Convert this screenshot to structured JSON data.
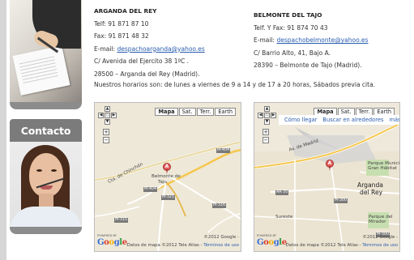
{
  "sidebar": {
    "contact_title": "Contacto"
  },
  "offices": [
    {
      "name": "ARGANDA DEL REY",
      "phone": "Telf: 91 871 87 10",
      "fax": "Fax: 91 871 48 32",
      "email_label": "E-mail: ",
      "email": "despachoarganda@yahoo.es",
      "address": "C/ Avenida del Ejercito 38 1ºC .",
      "city": "28500 – Arganda del Rey (Madrid)."
    },
    {
      "name": "BELMONTE DEL TAJO",
      "phone": "Telf. Y Fax: 91 874 70 43",
      "email_label": "E-mail: ",
      "email": "despachobelmonte@yahoo.es",
      "address": "C/ Barrio Alto, 41, Bajo A.",
      "city": "28390 – Belmonte de Tajo (Madrid)."
    }
  ],
  "hours_text": "Nuestros horarios son: de lunes a viernes de 9 a 14 y de 17 a 20 horas, Sábados previa cita.",
  "map_controls": {
    "types": [
      "Mapa",
      "Sat.",
      "Terr.",
      "Earth"
    ],
    "active_type": "Mapa",
    "pan_up": "▲",
    "pan_left": "◀",
    "pan_right": "▶",
    "pan_down": "▼",
    "pan_center": "◇",
    "zoom_in": "+",
    "zoom_out": "−"
  },
  "map1": {
    "marker_letter": "A",
    "place_label_1": "Belmonte de",
    "place_label_2": "Tajo",
    "road_label": "Cta. de Chinchón",
    "roads": [
      "M-404",
      "M-404",
      "M-321",
      "M-316",
      "M-315"
    ],
    "powered_by": "POWERED BY",
    "logo": "Google",
    "data_attribution": "Datos de mapa ©2012 Tele Atlas -",
    "terms": "Términos de uso",
    "copyright": "©2012 Google -"
  },
  "map2": {
    "marker_letter": "A",
    "toolbar": [
      "Cómo llegar",
      "Buscar en alrededores",
      "más »"
    ],
    "city_label_1": "Arganda",
    "city_label_2": "del Rey",
    "road_label": "Av. de Madrid",
    "park_1": "Parque Municipal\nGran Hábitat",
    "park_2": "Parque del\nMirador",
    "roads": [
      "AR-30",
      "M-300",
      "M-300"
    ],
    "label_misc": "Sureste",
    "powered_by": "POWERED BY",
    "logo": "Google",
    "data_attribution": "Datos de mapa ©2012 Tele Atlas -",
    "terms": "Términos de uso",
    "copyright": "©2012 Google -"
  },
  "colors": {
    "link": "#2a5db0",
    "sidebar_header": "#7b7b7b",
    "map_bg": "#efe9dc"
  }
}
